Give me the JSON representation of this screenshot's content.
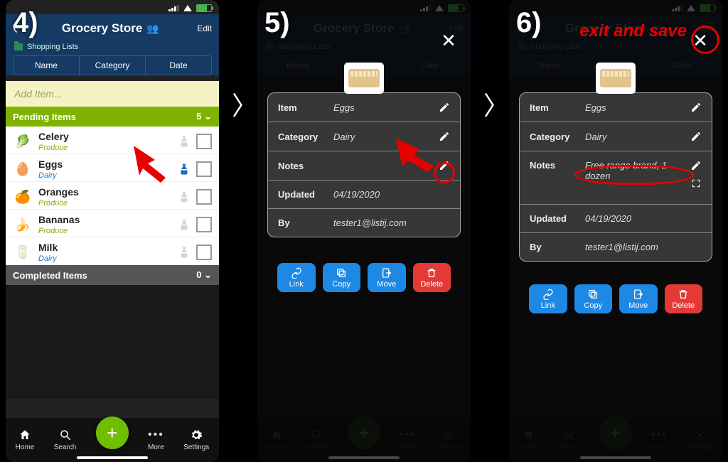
{
  "steps": {
    "s4": "4)",
    "s5": "5)",
    "s6": "6)"
  },
  "header": {
    "title": "Grocery Store",
    "edit": "Edit",
    "crumb": "Shopping Lists"
  },
  "tabs": {
    "name": "Name",
    "category": "Category",
    "date": "Date"
  },
  "additem_placeholder": "Add Item...",
  "sections": {
    "pending": {
      "label": "Pending Items",
      "count": "5"
    },
    "completed": {
      "label": "Completed Items",
      "count": "0"
    }
  },
  "items": [
    {
      "name": "Celery",
      "cat": "Produce",
      "catClass": "",
      "emoji": "🥬"
    },
    {
      "name": "Eggs",
      "cat": "Dairy",
      "catClass": "catD",
      "emoji": "🥚",
      "scopeActive": true
    },
    {
      "name": "Oranges",
      "cat": "Produce",
      "catClass": "",
      "emoji": "🍊"
    },
    {
      "name": "Bananas",
      "cat": "Produce",
      "catClass": "",
      "emoji": "🍌"
    },
    {
      "name": "Milk",
      "cat": "Dairy",
      "catClass": "catD",
      "emoji": "🥛"
    }
  ],
  "tabbar": {
    "home": "Home",
    "search": "Search",
    "more": "More",
    "settings": "Settings"
  },
  "card": {
    "labels": {
      "item": "Item",
      "category": "Category",
      "notes": "Notes",
      "updated": "Updated",
      "by": "By"
    },
    "values": {
      "item": "Eggs",
      "category": "Dairy",
      "updated": "04/19/2020",
      "by": "tester1@listij.com",
      "notes6": "Free range brand, 1 dozen"
    }
  },
  "actions": {
    "link": "Link",
    "copy": "Copy",
    "move": "Move",
    "delete": "Delete"
  },
  "annotation": {
    "exit": "exit and save"
  },
  "ghost": {
    "bananas": "nas",
    "milk": "Milk",
    "dairy": "Dairy"
  }
}
